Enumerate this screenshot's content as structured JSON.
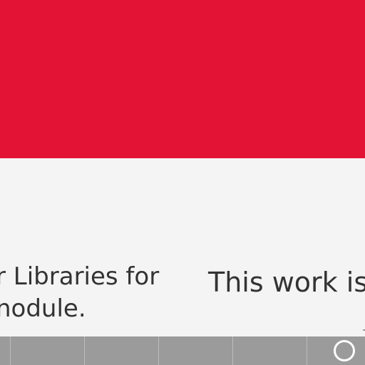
{
  "colors": {
    "banner": "#e31336",
    "page_background": "#f4f4f4",
    "text": "#333333",
    "bottom_bar": "#9b9b9b",
    "divider": "#bdbdbd",
    "icon": "#ffffff"
  },
  "content": {
    "left_text_line1": "r Libraries for",
    "left_text_line2": "nodule.",
    "right_text": "This work is"
  },
  "bottom_bar": {
    "home_icon": "circle-icon"
  }
}
